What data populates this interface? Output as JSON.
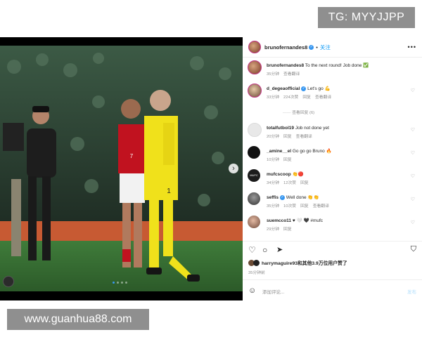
{
  "watermarks": {
    "top": "TG: MYYJJPP",
    "bottom": "www.guanhua88.com"
  },
  "header": {
    "username": "brunofernandes8",
    "follow": "关注"
  },
  "comments": [
    {
      "username": "brunofernandes8",
      "text": "To the next round! Job done ✅",
      "time": "35分钟",
      "likes": "",
      "reply": "",
      "translate": "查看翻译"
    },
    {
      "username": "d_degeaofficial",
      "text": "Let's go 💪",
      "time": "33分钟",
      "likes": "224次赞",
      "reply": "回复",
      "translate": "查看翻译",
      "view_replies": "查看回复 (6)"
    },
    {
      "username": "totalfutbol19",
      "text": "Job not done yet",
      "time": "20分钟",
      "likes": "",
      "reply": "回复",
      "translate": "查看翻译"
    },
    {
      "username": "_amine__el",
      "text": "Go go go Bruno 🔥",
      "time": "10分钟",
      "likes": "",
      "reply": "回复",
      "translate": ""
    },
    {
      "username": "mufcscoop",
      "text": "👏🔴",
      "time": "34分钟",
      "likes": "12次赞",
      "reply": "回复",
      "translate": ""
    },
    {
      "username": "seffis",
      "text": "Well done 👏👏",
      "time": "35分钟",
      "likes": "10次赞",
      "reply": "回复",
      "translate": "查看翻译"
    },
    {
      "username": "suemcco11",
      "text": "♥ 🤍 🖤 #mufc",
      "time": "29分钟",
      "likes": "",
      "reply": "回复",
      "translate": ""
    }
  ],
  "likes": {
    "text": "harrymaguire93和其他3.9万位用户赞了"
  },
  "post_time": "35分钟前",
  "add_comment": {
    "placeholder": "添加评论...",
    "post": "发布"
  },
  "colors": {
    "accent": "#0095f6",
    "verified": "#3897f0",
    "heart_red": "#ed4956"
  }
}
